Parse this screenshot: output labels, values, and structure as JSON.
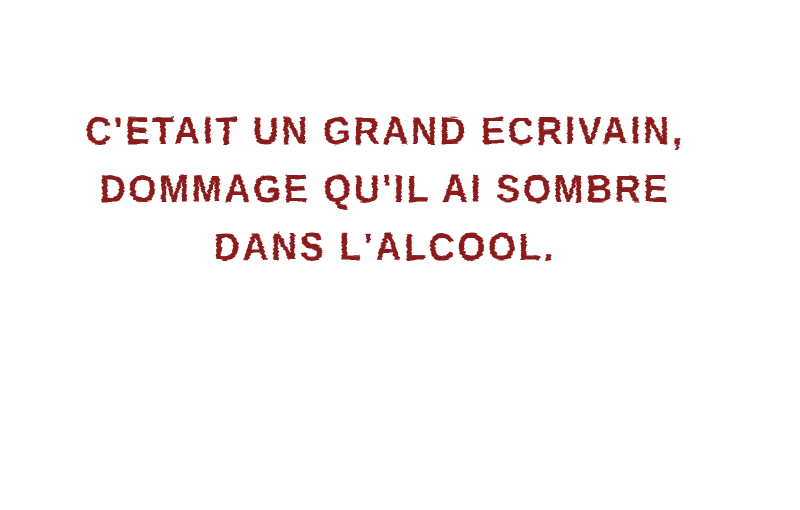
{
  "text_color": "#8b1a1a",
  "quote": {
    "lines": [
      "C'ETAIT UN GRAND ECRIVAIN,",
      "DOMMAGE QU'IL AI SOMBRE",
      "DANS L'ALCOOL."
    ]
  }
}
